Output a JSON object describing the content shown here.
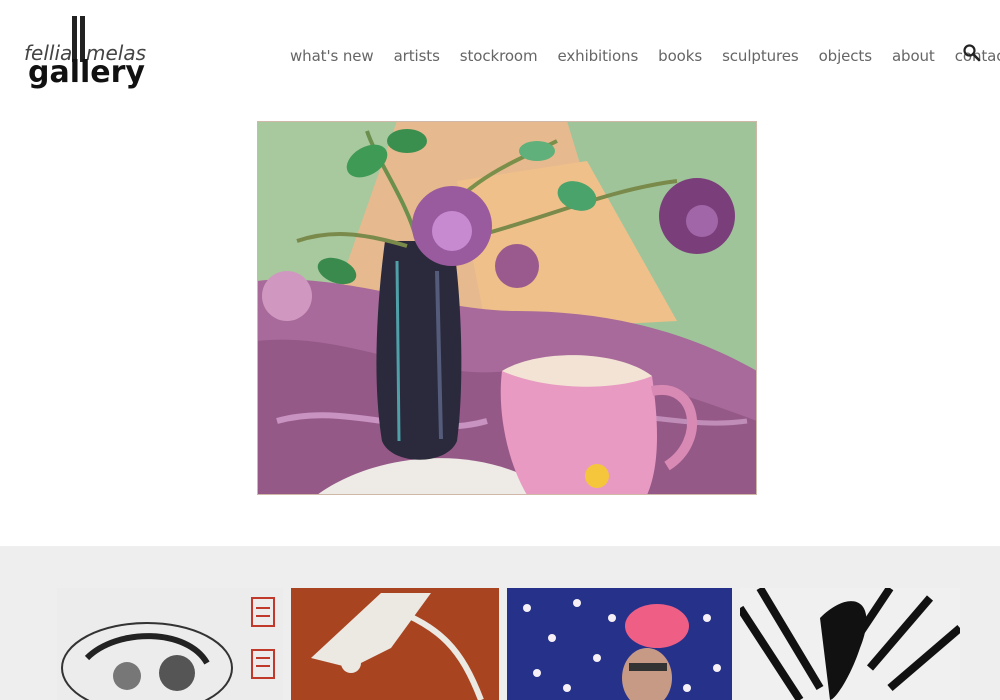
{
  "brand": {
    "logo_line1": "fellia",
    "logo_line1b": "melas",
    "logo_line2": "gallery"
  },
  "nav": {
    "items": [
      {
        "label": "what's new"
      },
      {
        "label": "artists"
      },
      {
        "label": "stockroom"
      },
      {
        "label": "exhibitions"
      },
      {
        "label": "books"
      },
      {
        "label": "sculptures"
      },
      {
        "label": "objects"
      },
      {
        "label": "about"
      },
      {
        "label": "contact"
      }
    ],
    "search_icon": "search-icon"
  },
  "hero": {
    "subject": "still life painting with purple flowers in dark vase and pink jug"
  },
  "colors": {
    "band_bg": "#eeeeee",
    "nav_text": "#666666"
  }
}
